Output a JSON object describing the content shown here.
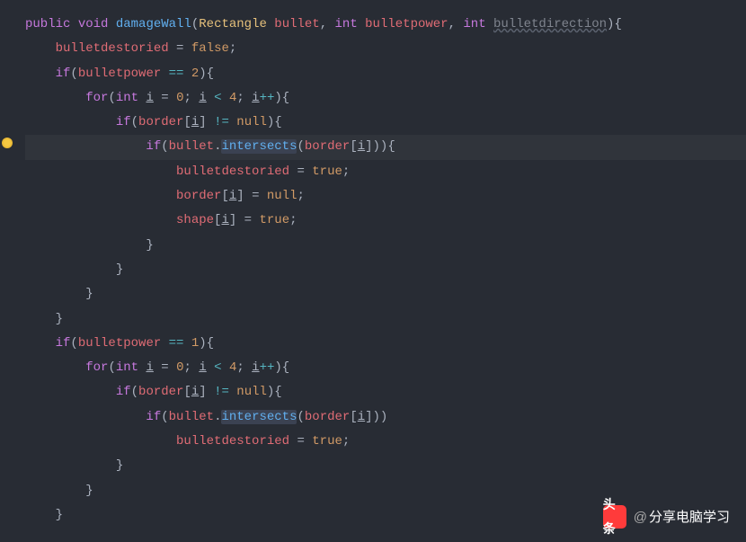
{
  "code": {
    "sig": {
      "kw_public": "public",
      "kw_void": "void",
      "method": "damageWall",
      "p1_type": "Rectangle",
      "p1_name": "bullet",
      "p2_type": "int",
      "p2_name": "bulletpower",
      "p3_type": "int",
      "p3_name": "bulletdirection",
      "open": "){"
    },
    "l2": {
      "field": "bulletdestoried",
      "eq": " = ",
      "val": "false",
      "semi": ";"
    },
    "l3": {
      "kw_if": "if",
      "open": "(",
      "field": "bulletpower",
      "op": " == ",
      "num": "2",
      "close": "){"
    },
    "l4": {
      "kw_for": "for",
      "open": "(",
      "type": "int",
      "var": "i",
      "eq": " = ",
      "start": "0",
      "s1": "; ",
      "var2": "i",
      "lt": " < ",
      "end": "4",
      "s2": "; ",
      "var3": "i",
      "inc": "++",
      "close": "){"
    },
    "l5": {
      "kw_if": "if",
      "open": "(",
      "field": "border",
      "b1": "[",
      "idx": "i",
      "b2": "]",
      "op": " != ",
      "null": "null",
      "close": "){"
    },
    "l6": {
      "kw_if": "if",
      "open": "(",
      "var": "bullet",
      "dot": ".",
      "call": "intersects",
      "p1": "(",
      "field": "border",
      "b1": "[",
      "idx": "i",
      "b2": "]",
      "close": ")){"
    },
    "l7": {
      "field": "bulletdestoried",
      "eq": " = ",
      "val": "true",
      "semi": ";"
    },
    "l8": {
      "field": "border",
      "b1": "[",
      "idx": "i",
      "b2": "]",
      "eq": " = ",
      "null": "null",
      "semi": ";"
    },
    "l9": {
      "field": "shape",
      "b1": "[",
      "idx": "i",
      "b2": "]",
      "eq": " = ",
      "val": "true",
      "semi": ";"
    },
    "cb": "}",
    "l14": {
      "kw_if": "if",
      "open": "(",
      "field": "bulletpower",
      "op": " == ",
      "num": "1",
      "close": "){"
    },
    "l17": {
      "kw_if": "if",
      "open": "(",
      "var": "bullet",
      "dot": ".",
      "call": "intersects",
      "p1": "(",
      "field": "border",
      "b1": "[",
      "idx": "i",
      "b2": "]",
      "close": "))"
    }
  },
  "watermark": {
    "icon": "头条",
    "at": "@",
    "text": "分享电脑学习"
  }
}
